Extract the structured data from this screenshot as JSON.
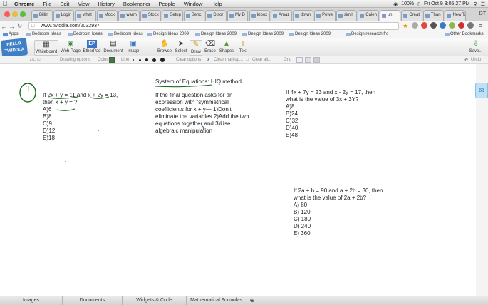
{
  "os_menu": {
    "apple": "",
    "app": "Chrome",
    "items": [
      "File",
      "Edit",
      "View",
      "History",
      "Bookmarks",
      "People",
      "Window",
      "Help"
    ],
    "battery": "100%",
    "clock": "Fri Oct 9  3:05:27 PM",
    "user": "DT"
  },
  "tabs": [
    "Billin",
    "Login",
    "what",
    "Mock",
    "warm",
    "Stock",
    "Setup",
    "Benc",
    "Disor",
    "My D",
    "Inbox",
    "Amaz",
    "down",
    "Powe",
    "simil",
    "Calen",
    "un",
    "Creat",
    "Than",
    "New Tab"
  ],
  "address": {
    "url": "www.twiddla.com/2032937"
  },
  "bookmarks": {
    "apps": "Apps",
    "items": [
      "Bedroom Ideas",
      "Bedroom Ideas",
      "Bedroom Ideas",
      "Design Ideas 2009",
      "Design Ideas 2009",
      "Design Ideas 2009",
      "Design Ideas 2009",
      "Design research fro"
    ],
    "other": "Other Bookmarks"
  },
  "logo": {
    "line1": "HELLO",
    "line2": "TWIDDLA"
  },
  "toolbar": {
    "whiteboard": "Whiteboard",
    "webpage": "Web Page",
    "etherpad": "EtherPad",
    "document": "Document",
    "image": "Image",
    "browse": "Browse",
    "select": "Select",
    "draw": "Draw",
    "erase": "Erase",
    "shapes": "Shapes",
    "text": "Text",
    "save": "Save..."
  },
  "options": {
    "drawing": "Drawing options",
    "color": "Color:",
    "line": "Line:",
    "clear_opts": "Clear options",
    "clear_markup": "Clear markup...",
    "clear_all": "Clear all...",
    "grid": "Grid",
    "undo": "Undo"
  },
  "icons": {
    "logo_color": "#3e7fc6",
    "accent": "#2a7bbd"
  },
  "board": {
    "heading": "System of Equations",
    "heading_rest": ": HIQ method.",
    "circle_num": "1",
    "q1": [
      "If 2x + y = 11 and x + 2y = 13,",
      "then x + y = ?",
      "A)6",
      "B)8",
      "C)9",
      "D)12",
      "E)18"
    ],
    "method": [
      "If the final question asks for an",
      "expression with \"symmetrical",
      "coefficients for x + y— 1)Don't",
      "eliminate the variables 2)Add the two",
      "equations together and 3)Use",
      "algebraic manipulation"
    ],
    "q2": [
      "If 4x + 7y = 23 and x - 2y = 17, then",
      "what is the value of 3x + 3Y?",
      "A)8",
      "B)24",
      "C)32",
      "D)40",
      "E)48"
    ],
    "q3": [
      "If 2a + b = 90 and a + 2b = 30, then",
      "what is the value of 2a + 2b?",
      "A) 80",
      "B) 120",
      "C) 180",
      "D) 240",
      "E) 360"
    ]
  },
  "bottom_tabs": [
    "Images",
    "Documents",
    "Widgets & Code",
    "Mathematical Formulas"
  ]
}
